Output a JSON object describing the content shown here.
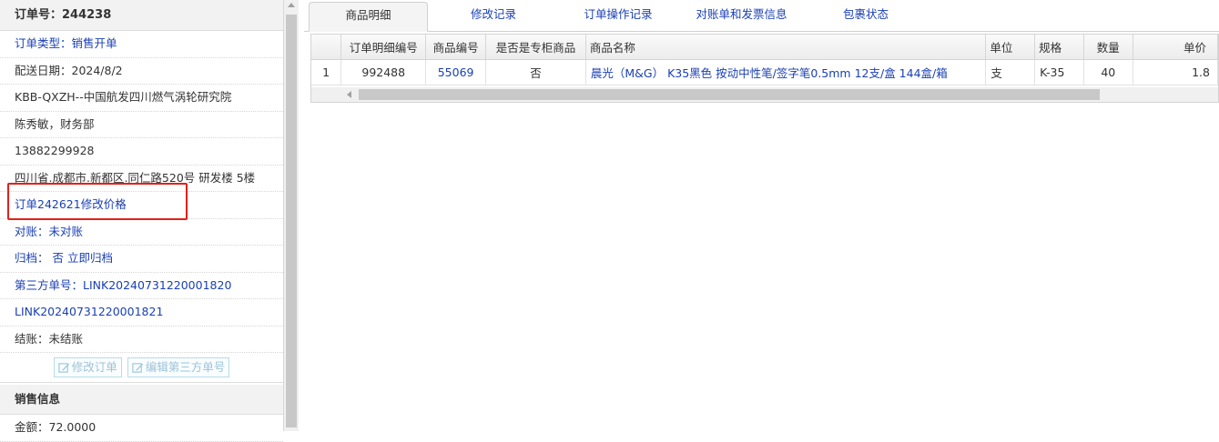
{
  "order": {
    "title": "订单号：244238",
    "rows": [
      "订单类型：销售开单",
      "配送日期：2024/8/2",
      "KBB-QXZH--中国航发四川燃气涡轮研究院",
      "陈秀敏，财务部",
      "13882299928",
      "四川省.成都市.新都区.同仁路520号 研发楼 5楼",
      "订单242621修改价格",
      "对账：未对账",
      "归档：  否 立即归档",
      "第三方单号：LINK20240731220001820",
      "LINK20240731220001821",
      "结账：未结账"
    ],
    "edit_order_label": "修改订单",
    "edit_third_party_label": "编辑第三方单号"
  },
  "sales": {
    "title": "销售信息",
    "amount": "金额：72.0000"
  },
  "tabs": [
    "商品明细",
    "修改记录",
    "订单操作记录",
    "对账单和发票信息",
    "包裹状态"
  ],
  "table": {
    "headers": [
      "",
      "订单明细编号",
      "商品编号",
      "是否是专柜商品",
      "商品名称",
      "单位",
      "规格",
      "数量",
      "单价"
    ],
    "rows": [
      [
        "1",
        "992488",
        "55069",
        "否",
        "晨光（M&G） K35黑色 按动中性笔/签字笔0.5mm 12支/盒 144盒/箱",
        "支",
        "K-35",
        "40",
        "1.8"
      ]
    ]
  },
  "colors": {
    "link": "#1a3fb5",
    "highlight_box": "#e0211a"
  }
}
